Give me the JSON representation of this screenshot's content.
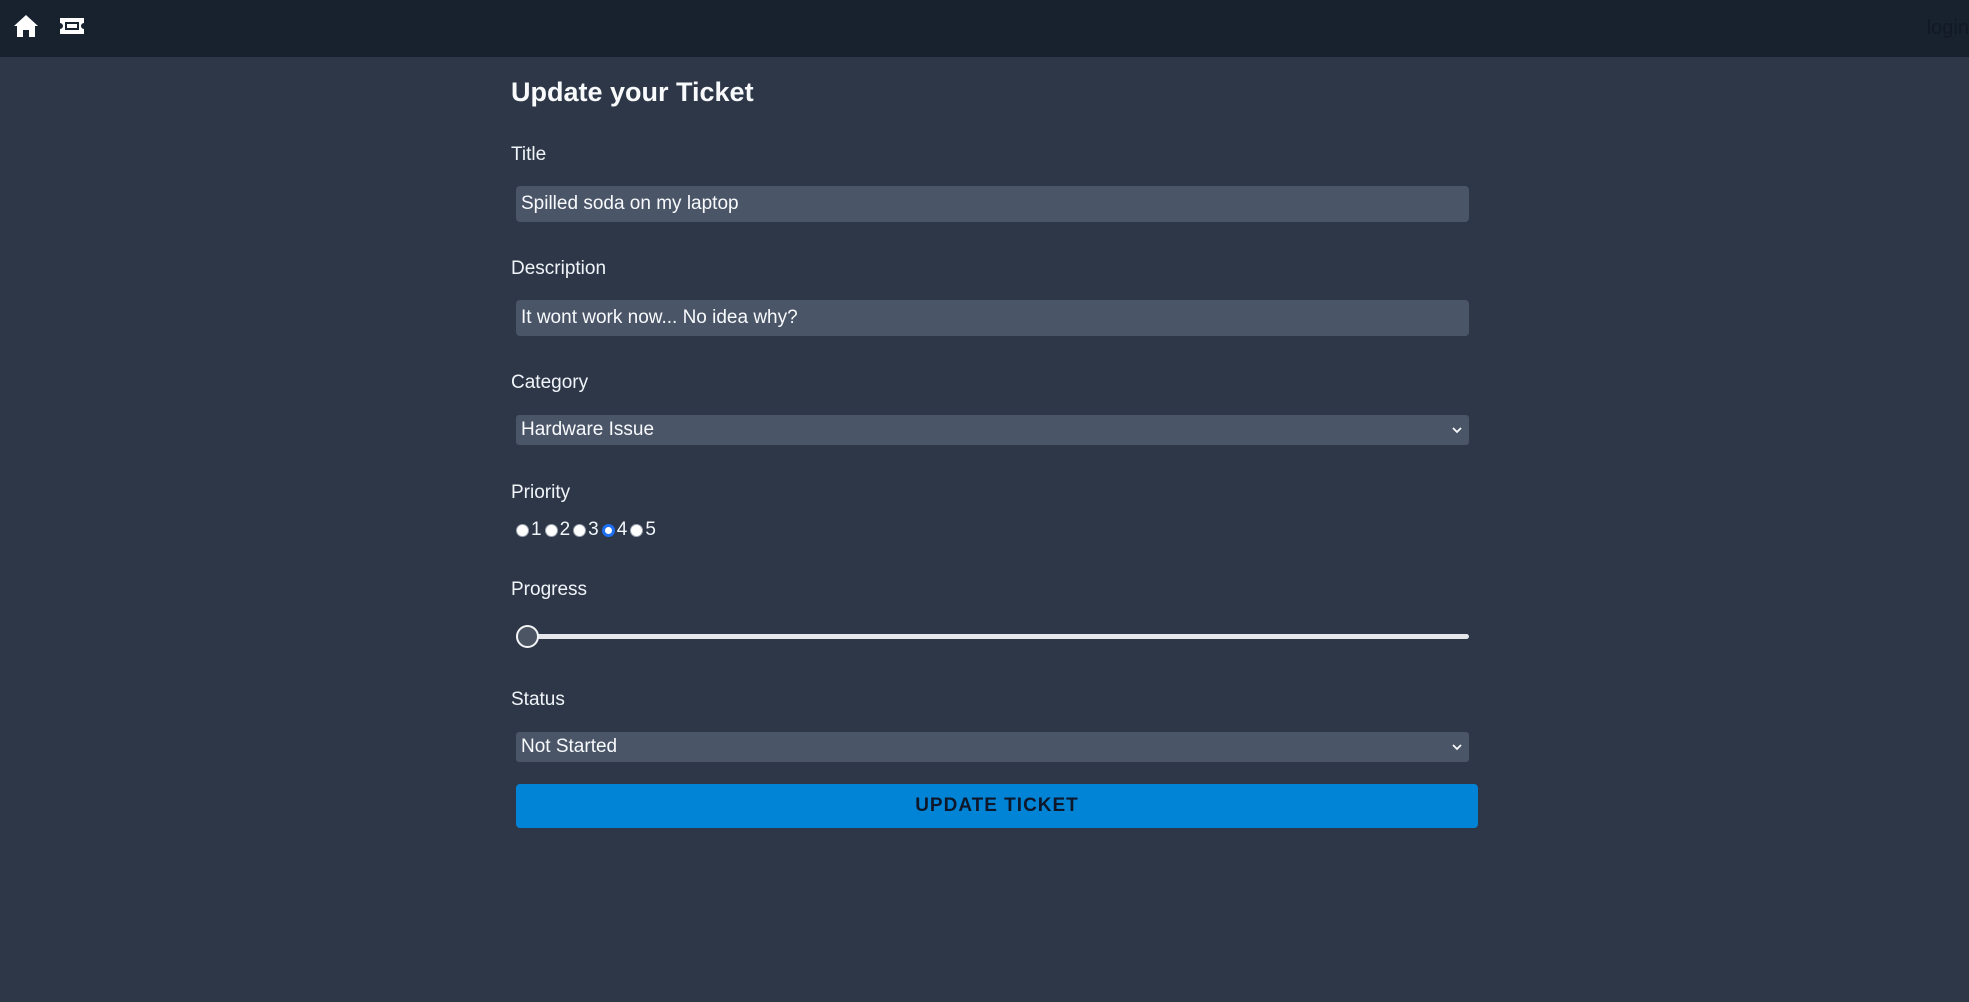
{
  "nav": {
    "home_icon": "home-icon",
    "ticket_icon": "ticket-icon",
    "login_label": "login"
  },
  "form": {
    "heading": "Update your Ticket",
    "title": {
      "label": "Title",
      "value": "Spilled soda on my laptop"
    },
    "description": {
      "label": "Description",
      "value": "It wont work now... No idea why?"
    },
    "category": {
      "label": "Category",
      "selected": "Hardware Issue"
    },
    "priority": {
      "label": "Priority",
      "options": [
        "1",
        "2",
        "3",
        "4",
        "5"
      ],
      "selected": "4"
    },
    "progress": {
      "label": "Progress",
      "value_fraction": 0
    },
    "status": {
      "label": "Status",
      "selected": "Not Started"
    },
    "submit_label": "UPDATE TICKET"
  },
  "colors": {
    "page_bg": "#2d3748",
    "topbar_bg": "#18222f",
    "input_bg": "#4a5568",
    "button_bg": "#0284d6",
    "radio_accent": "#1e6ff1"
  }
}
